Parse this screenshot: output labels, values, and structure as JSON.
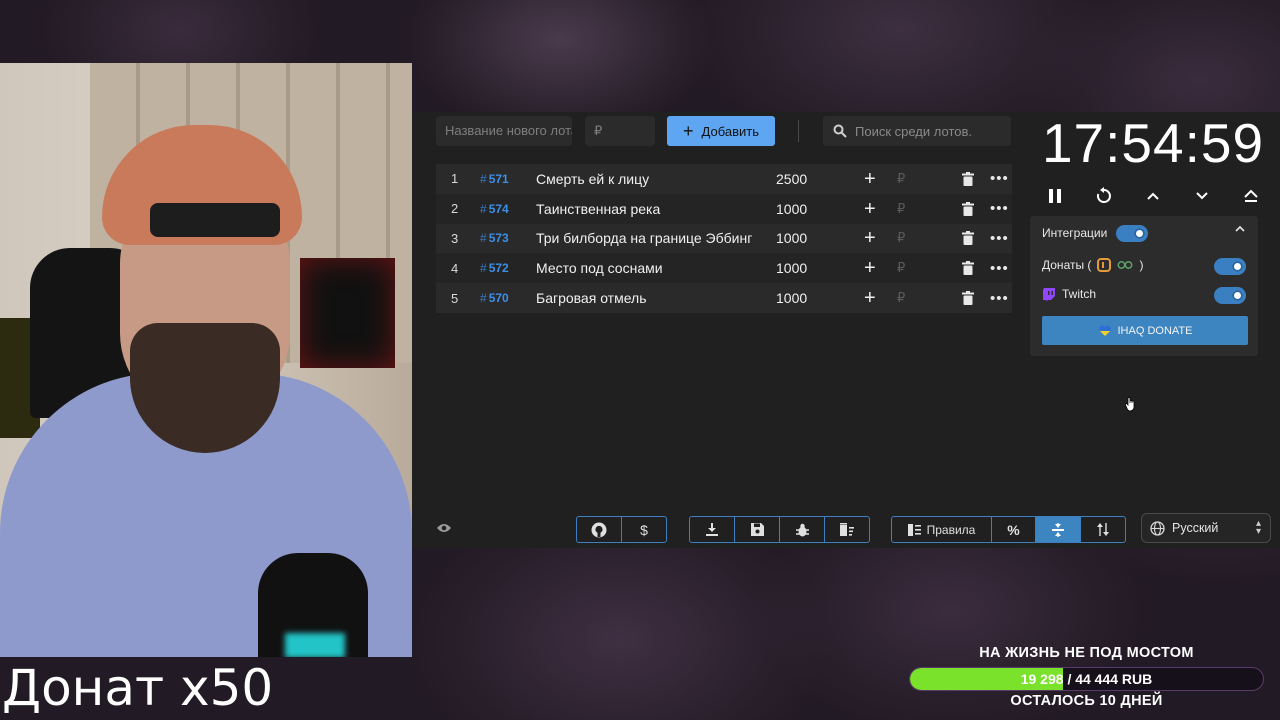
{
  "webcam": {
    "overlay_text": "Донат x50"
  },
  "toolbar": {
    "lot_name_placeholder": "Название нового лота",
    "lot_price_placeholder": "₽",
    "add_label": "Добавить",
    "search_placeholder": "Поиск среди лотов."
  },
  "lots": [
    {
      "index": "1",
      "id": "571",
      "name": "Смерть ей к лицу",
      "amount": "2500"
    },
    {
      "index": "2",
      "id": "574",
      "name": "Таинственная река",
      "amount": "1000"
    },
    {
      "index": "3",
      "id": "573",
      "name": "Три билборда на границе Эббинг",
      "amount": "1000"
    },
    {
      "index": "4",
      "id": "572",
      "name": "Место под соснами",
      "amount": "1000"
    },
    {
      "index": "5",
      "id": "570",
      "name": "Багровая отмель",
      "amount": "1000"
    }
  ],
  "row_labels": {
    "hash": "#",
    "plus": "+",
    "currency": "₽",
    "more": "•••"
  },
  "timer": {
    "time": "17:54:59"
  },
  "integrations": {
    "title": "Интеграции",
    "enabled": true,
    "donations_label": "Донаты (",
    "donations_suffix": ")",
    "donations_enabled": true,
    "twitch_label": "Twitch",
    "twitch_enabled": true,
    "donate_button_label": "IHAQ DONATE"
  },
  "footer": {
    "rules_label": "Правила",
    "percent_label": "%",
    "language": "Русский"
  },
  "goal": {
    "title": "НА ЖИЗНЬ НЕ ПОД МОСТОМ",
    "current": "19 298",
    "separator": "/",
    "target": "44 444 RUB",
    "progress": 0.434,
    "subtitle": "ОСТАЛОСЬ 10 ДНЕЙ"
  },
  "colors": {
    "accent": "#5fa6f2",
    "lot_id": "#3d8ee6",
    "toggle": "#3a7fc2",
    "goal_fill": "#7ae22b"
  }
}
